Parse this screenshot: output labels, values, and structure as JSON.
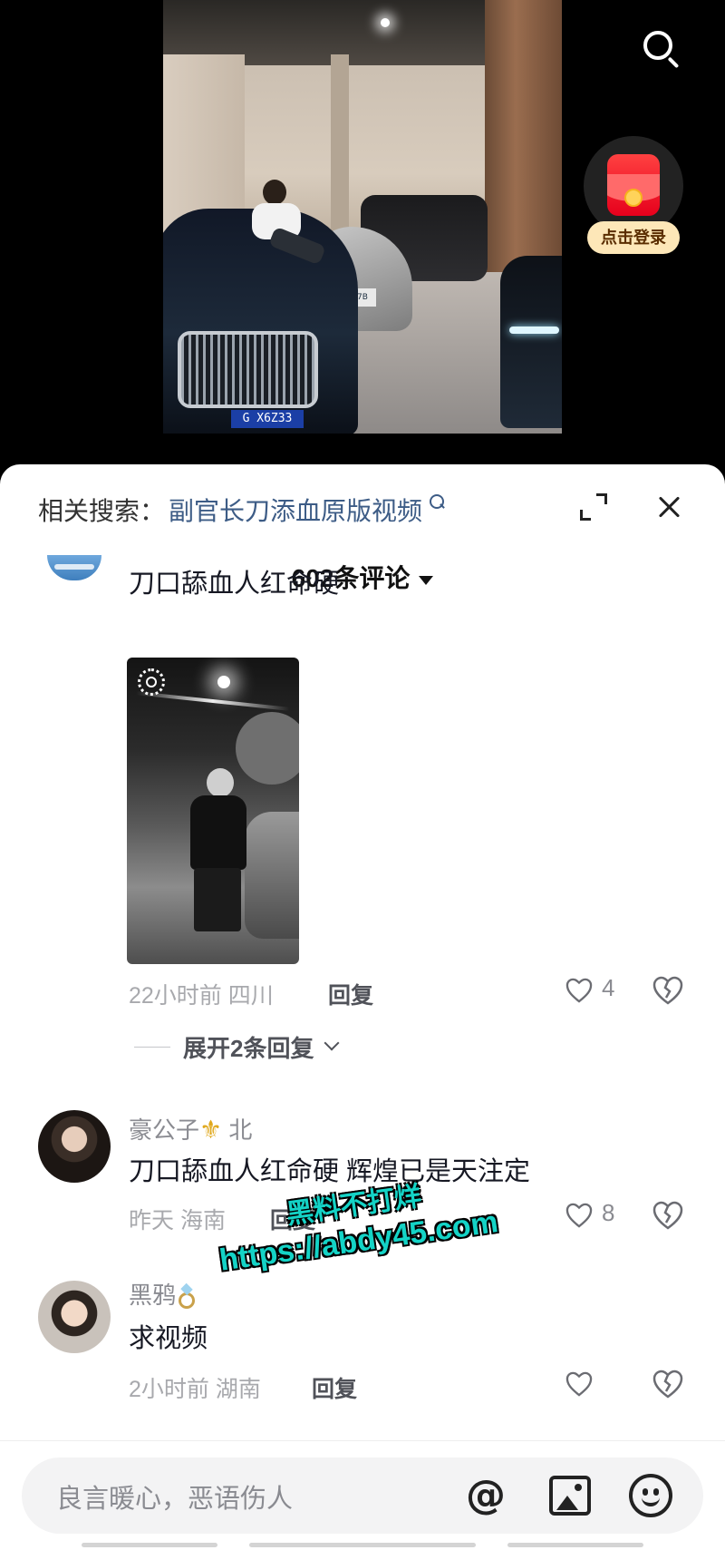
{
  "video": {
    "plate_main": "G X6Z33",
    "plate_silver": "7B"
  },
  "login": {
    "label": "点击登录"
  },
  "comment_panel": {
    "related_label": "相关搜索：",
    "related_query": "副官长刀添血原版视频",
    "comment_count": "602条评论"
  },
  "comments": [
    {
      "username": "",
      "text": "刀口舔血人红命硬",
      "time": "22小时前 四川",
      "reply_label": "回复",
      "likes": "4",
      "expand_replies": "展开2条回复"
    },
    {
      "username": "豪公子",
      "username_suffix": "北",
      "text": "刀口舔血人红命硬 辉煌已是天注定",
      "time": "昨天 海南",
      "reply_label": "回复",
      "likes": "8"
    },
    {
      "username": "黑鸦",
      "text": "求视频",
      "time": "2小时前 湖南",
      "reply_label": "回复",
      "likes": ""
    }
  ],
  "watermark": {
    "line1": "黑料不打烊",
    "line2": "https://abdy45.com"
  },
  "input": {
    "placeholder": "良言暖心，恶语伤人"
  },
  "colors": {
    "accent_link": "#3d5c86",
    "watermark": "#14d3c6",
    "login_badge": "#fde7b8",
    "red_envelope": "#e6001c"
  }
}
